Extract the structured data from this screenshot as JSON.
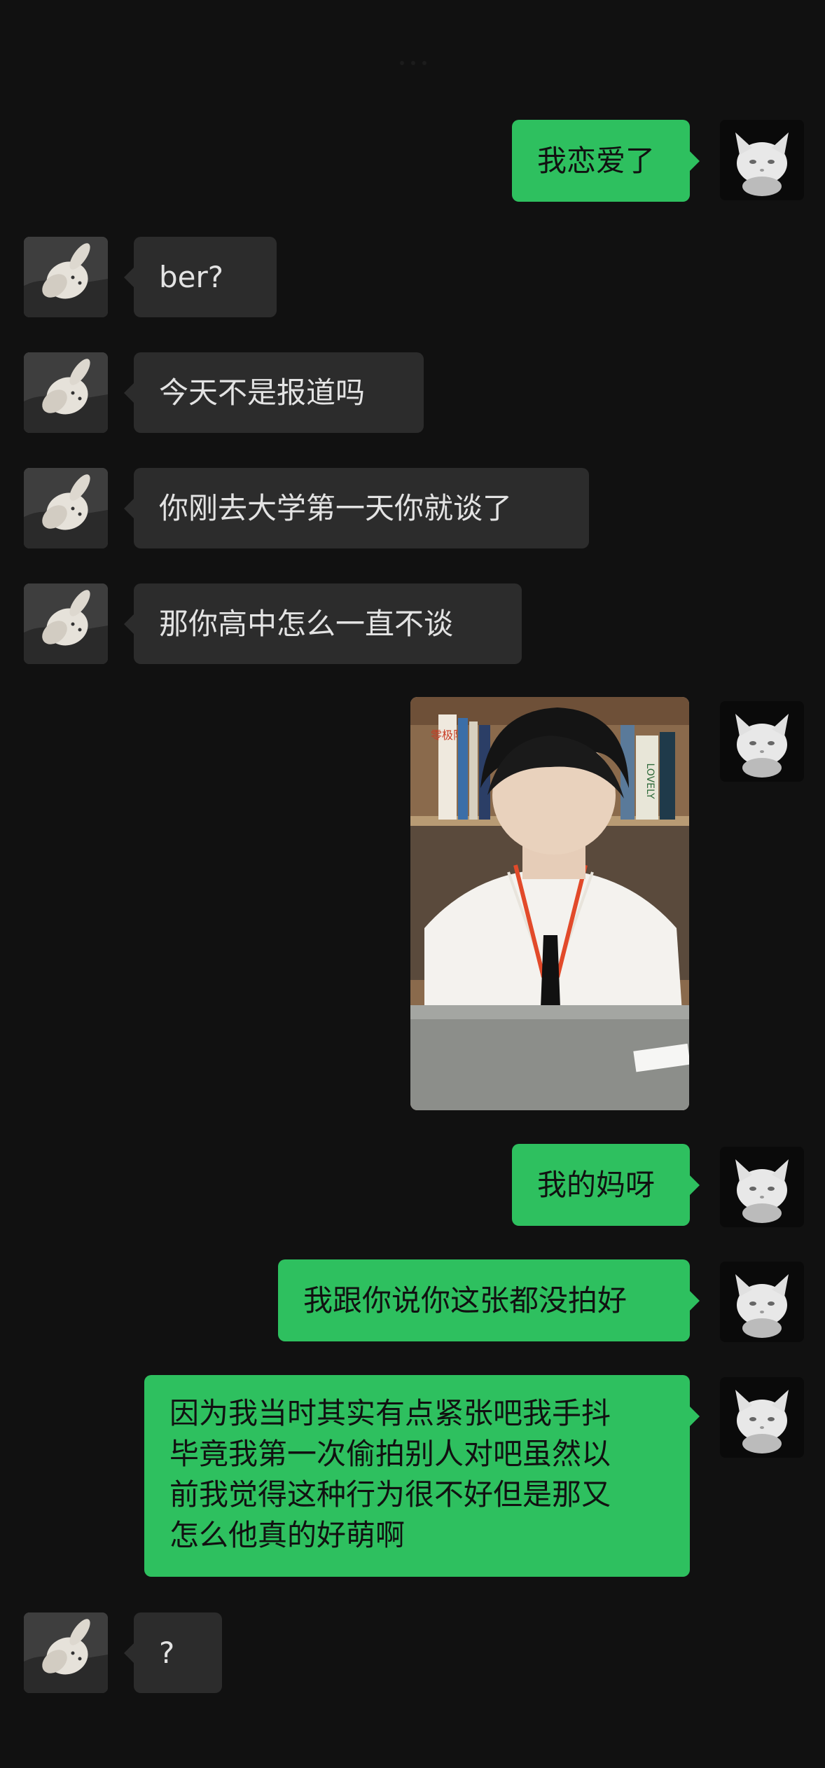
{
  "conversation": {
    "messages": [
      {
        "side": "out",
        "text": "我恋爱了"
      },
      {
        "side": "in",
        "text": "ber?"
      },
      {
        "side": "in",
        "text": "今天不是报道吗"
      },
      {
        "side": "in",
        "text": "你刚去大学第一天你就谈了"
      },
      {
        "side": "in",
        "text": "那你高中怎么一直不谈"
      },
      {
        "side": "out",
        "type": "image",
        "image": "photo-boy-at-desk"
      },
      {
        "side": "out",
        "text": "我的妈呀"
      },
      {
        "side": "out",
        "text": "我跟你说你这张都没拍好"
      },
      {
        "side": "out",
        "text": "因为我当时其实有点紧张吧我手抖\n毕竟我第一次偷拍别人对吧虽然以\n前我觉得这种行为很不好但是那又\n怎么他真的好萌啊"
      },
      {
        "side": "in",
        "text": "?"
      }
    ]
  },
  "photo": {
    "book_spines": [
      "零极限",
      "LOVELY"
    ]
  },
  "theme": {
    "background": "#111111",
    "incoming_bubble": "#2c2c2c",
    "outgoing_bubble": "#2ec05f",
    "incoming_text": "#e3e3e3",
    "outgoing_text": "#111111"
  },
  "icons": {
    "contact_avatar": "plush-bunny-avatar",
    "self_avatar": "white-cat-avatar"
  }
}
